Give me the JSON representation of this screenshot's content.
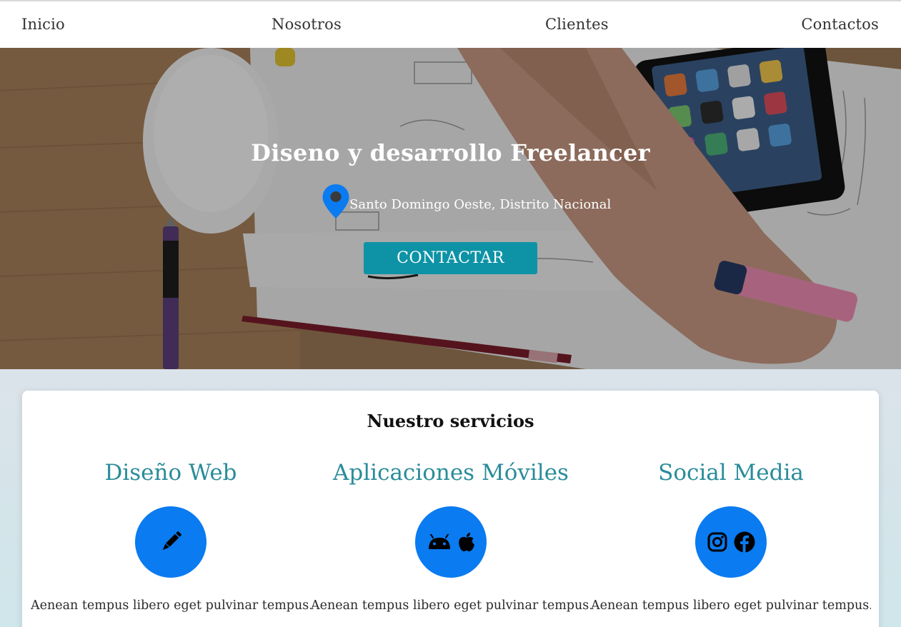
{
  "nav": {
    "items": [
      {
        "label": "Inicio"
      },
      {
        "label": "Nosotros"
      },
      {
        "label": "Clientes"
      },
      {
        "label": "Contactos"
      }
    ]
  },
  "hero": {
    "title": "Diseno y desarrollo Freelancer",
    "location_icon": "map-pin-icon",
    "location": "Santo Domingo Oeste, Distrito Nacional",
    "cta_label": "CONTACTAR",
    "cta_color": "#0e93a6"
  },
  "services": {
    "title": "Nuestro servicios",
    "items": [
      {
        "title": "Diseño Web",
        "icons": [
          "pencil-icon"
        ],
        "text": "Aenean tempus libero eget pulvinar tempus. Ut"
      },
      {
        "title": "Aplicaciones Móviles",
        "icons": [
          "android-icon",
          "apple-icon"
        ],
        "text": "Aenean tempus libero eget pulvinar tempus. Ut"
      },
      {
        "title": "Social Media",
        "icons": [
          "instagram-icon",
          "facebook-icon"
        ],
        "text": "Aenean tempus libero eget pulvinar tempus. Ut"
      }
    ],
    "title_color": "#2a8c9a",
    "circle_color": "#0a7bf0"
  }
}
